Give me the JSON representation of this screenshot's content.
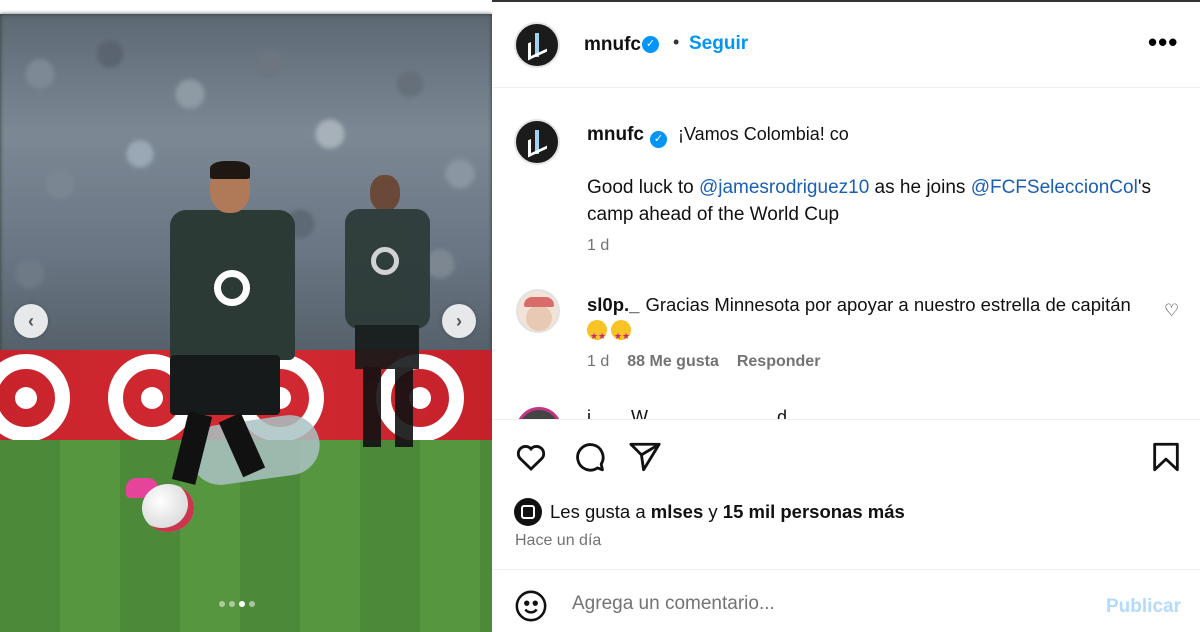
{
  "media": {
    "carousel_dots_total": 4,
    "carousel_dots_active": 3
  },
  "header": {
    "username": "mnufc",
    "verified": "✓",
    "separator": "•",
    "follow_label": "Seguir",
    "more_label": "•••"
  },
  "caption": {
    "username": "mnufc",
    "verified": "✓",
    "title": "¡Vamos Colombia! co",
    "body_prefix": "Good luck to ",
    "mention1": "@jamesrodriguez10",
    "body_middle": " as he joins ",
    "mention2": "@FCFSeleccionCol",
    "body_suffix": "'s camp ahead of the World Cup",
    "time": "1 d"
  },
  "comment": {
    "username": "sl0p._",
    "text": "Gracias Minnesota por apoyar a nuestro estrella de capitán",
    "time": "1 d",
    "likes": "88 Me gusta",
    "reply_label": "Responder"
  },
  "next_comment": {
    "partial_text": "j... ... W...... ......... ........ d..."
  },
  "likes": {
    "prefix": "Les gusta a ",
    "user": "mlses",
    "middle": " y ",
    "count": "15 mil personas más"
  },
  "posted": "Hace un día",
  "comment_box": {
    "placeholder": "Agrega un comentario...",
    "publish_label": "Publicar"
  },
  "colors": {
    "accent": "#0095f6",
    "mention": "#1a5fb4",
    "muted": "#737373",
    "publish_disabled": "#b3dbff"
  }
}
